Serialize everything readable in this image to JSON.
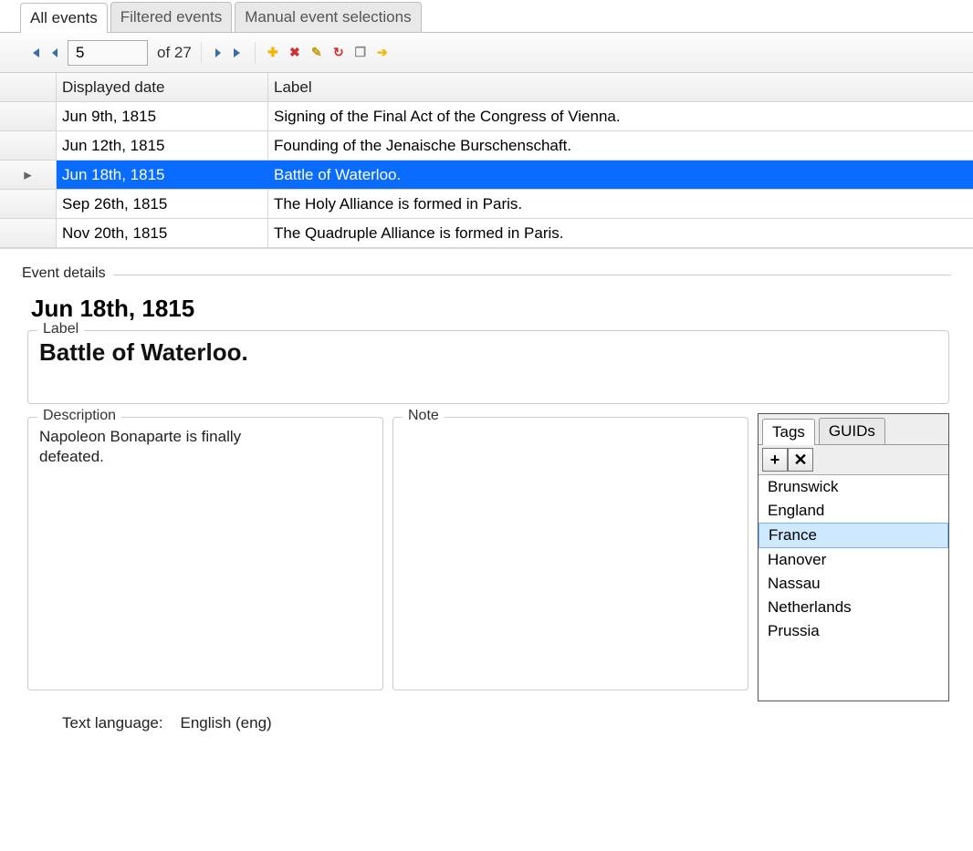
{
  "tabs": {
    "all_events": "All events",
    "filtered_events": "Filtered events",
    "manual_selections": "Manual event selections"
  },
  "paging": {
    "current": "5",
    "of_label": "of 27"
  },
  "grid_headers": {
    "date": "Displayed date",
    "label": "Label"
  },
  "rows": [
    {
      "date": "Jun 9th, 1815",
      "label": "Signing of the Final Act of the Congress of Vienna."
    },
    {
      "date": "Jun 12th, 1815",
      "label": "Founding of the Jenaische Burschenschaft."
    },
    {
      "date": "Jun 18th, 1815",
      "label": "Battle of Waterloo."
    },
    {
      "date": "Sep 26th, 1815",
      "label": "The Holy Alliance is formed in Paris."
    },
    {
      "date": "Nov 20th, 1815",
      "label": "The Quadruple Alliance is formed in Paris."
    }
  ],
  "selected_row_index": 2,
  "details": {
    "section_title": "Event details",
    "date_heading": "Jun 18th, 1815",
    "label_legend": "Label",
    "label_text": "Battle of Waterloo.",
    "description_legend": "Description",
    "description_text": "Napoleon Bonaparte is finally defeated.",
    "note_legend": "Note",
    "note_text": ""
  },
  "tags_panel": {
    "tab_tags": "Tags",
    "tab_guids": "GUIDs",
    "items": [
      "Brunswick",
      "England",
      "France",
      "Hanover",
      "Nassau",
      "Netherlands",
      "Prussia"
    ],
    "selected_index": 2
  },
  "language": {
    "label": "Text language:",
    "value": "English (eng)"
  }
}
